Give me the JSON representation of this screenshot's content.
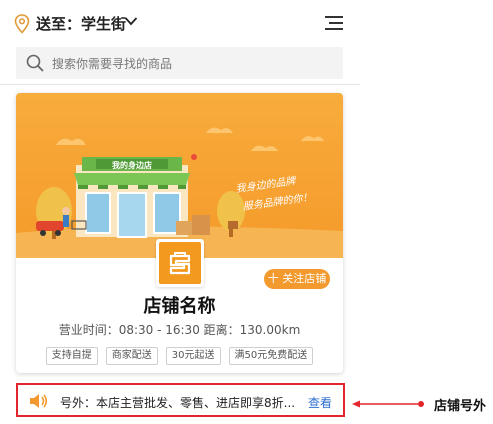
{
  "header": {
    "location_label": "送至：学生街",
    "icons": {
      "location": "location-pin-icon",
      "dropdown": "chevron-down-icon",
      "menu": "menu-icon"
    }
  },
  "search": {
    "placeholder": "搜索你需要寻找的商品",
    "icon": "search-icon"
  },
  "store": {
    "banner_sign": "我的身边店",
    "banner_slogan_1": "我身边的品牌",
    "banner_slogan_2": "服务品牌的你！",
    "follow_label": "十 关注店铺",
    "name": "店铺名称",
    "info": "营业时间：08:30 - 16:30  距离：130.00km",
    "tags": [
      "支持自提",
      "商家配送",
      "30元起送",
      "满50元免费配送"
    ],
    "colors": {
      "accent": "#f29a2e",
      "banner_bg": "#f7a73a"
    }
  },
  "notice": {
    "text": "号外：本店主营批发、零售、进店即享8折...",
    "link_label": "查看",
    "icon": "speaker-icon"
  },
  "annotation": {
    "label": "店铺号外",
    "color": "#e3262c"
  }
}
